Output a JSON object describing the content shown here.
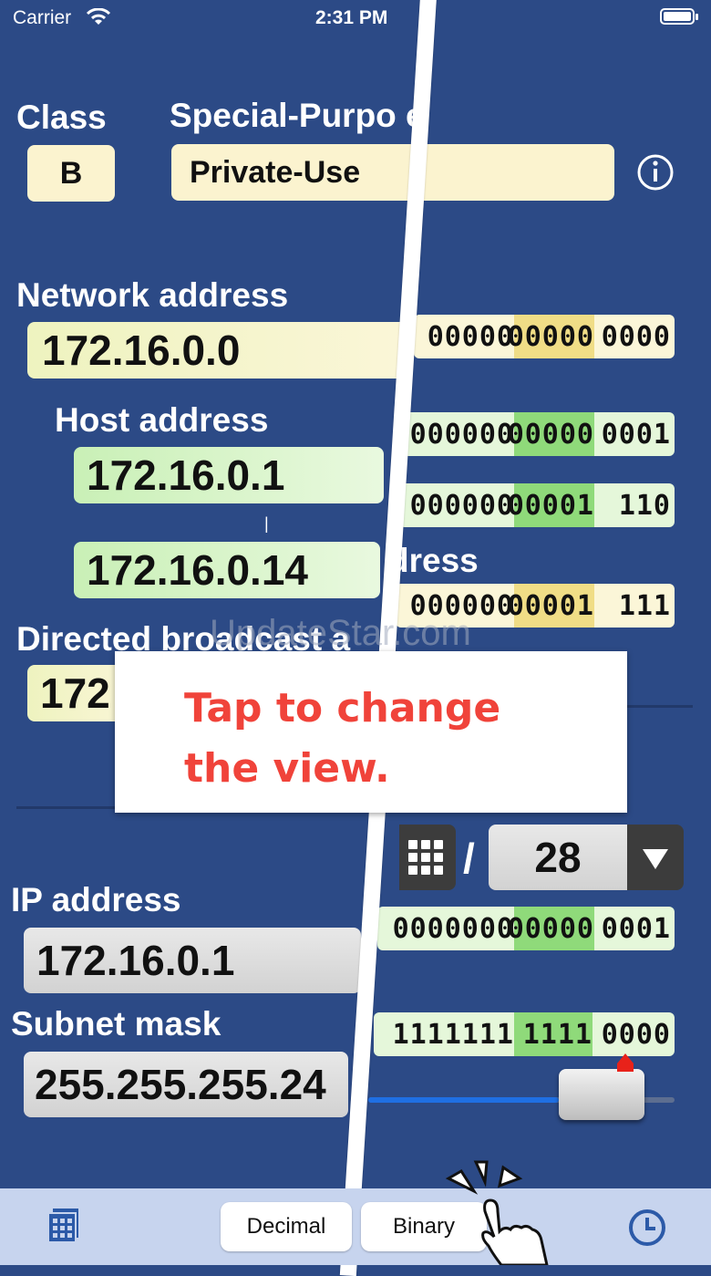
{
  "status_bar": {
    "carrier": "Carrier",
    "time": "2:31 PM"
  },
  "class": {
    "label": "Class",
    "value": "B"
  },
  "special": {
    "label": "Special-Purpo e",
    "value": "Private-Use"
  },
  "network": {
    "label": "Network address",
    "value": "172.16.0.0",
    "binary": [
      "00000",
      "00000",
      "0000"
    ]
  },
  "host": {
    "label": "Host address",
    "first": "172.16.0.1",
    "separator": "|",
    "last": "172.16.0.14",
    "first_binary": [
      "000000",
      "00000",
      "0001"
    ],
    "last_binary": [
      "000000",
      "00001",
      "110"
    ]
  },
  "broadcast": {
    "label": "Directed broadcast a",
    "value": "172",
    "hidden_label_tail": "dress",
    "binary": [
      "000000",
      "00001",
      "111"
    ]
  },
  "prefix": {
    "slash": "/",
    "value": "28"
  },
  "ip": {
    "label": "IP address",
    "value": "172.16.0.1",
    "binary": [
      "0000000",
      "00000",
      "0001"
    ]
  },
  "mask": {
    "label": "Subnet mask",
    "value": "255.255.255.24",
    "binary": [
      "1111111",
      "1111",
      "0000"
    ],
    "slider_fraction": 0.875
  },
  "popup": {
    "line1": "Tap to change",
    "line2": "the view."
  },
  "watermark": "UpdateStar.com",
  "tabs": {
    "decimal": "Decimal",
    "binary": "Binary"
  },
  "icons": [
    "info-icon",
    "calculator-icon",
    "keypad-icon",
    "dropdown-triangle-icon",
    "clock-icon",
    "tap-hand-icon"
  ]
}
